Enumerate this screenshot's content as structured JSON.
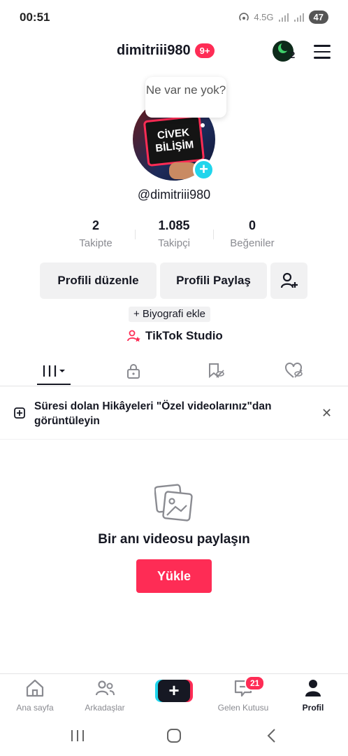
{
  "status_bar": {
    "time": "00:51",
    "network": "4.5G",
    "battery": "47"
  },
  "header": {
    "username": "dimitriii980",
    "notifications_badge": "9+",
    "account_count": "2"
  },
  "profile": {
    "avatar_text": "CİVEK BİLİŞİM",
    "bubble_text": "Ne var ne yok?",
    "handle": "@dimitriii980",
    "stats": [
      {
        "value": "2",
        "label": "Takipte"
      },
      {
        "value": "1.085",
        "label": "Takipçi"
      },
      {
        "value": "0",
        "label": "Beğeniler"
      }
    ],
    "edit_button": "Profili düzenle",
    "share_button": "Profili Paylaş",
    "bio_button": "+ Biyografi ekle",
    "studio_label": "TikTok Studio"
  },
  "tabs": [
    {
      "name": "videos-grid",
      "icon": "grid-icon"
    },
    {
      "name": "private",
      "icon": "lock-icon"
    },
    {
      "name": "saved",
      "icon": "bookmark-hidden-icon"
    },
    {
      "name": "liked",
      "icon": "heart-hidden-icon"
    }
  ],
  "notice": {
    "text": "Süresi dolan Hikâyeleri \"Özel videolarınız\"dan görüntüleyin"
  },
  "empty_state": {
    "title": "Bir anı videosu paylaşın",
    "upload_button": "Yükle"
  },
  "bottom_nav": {
    "home": "Ana sayfa",
    "friends": "Arkadaşlar",
    "inbox": "Gelen Kutusu",
    "inbox_badge": "21",
    "profile": "Profil"
  },
  "colors": {
    "accent": "#FE2C55",
    "cyan": "#20D5EC",
    "text": "#161823",
    "muted": "#8a8b91"
  }
}
